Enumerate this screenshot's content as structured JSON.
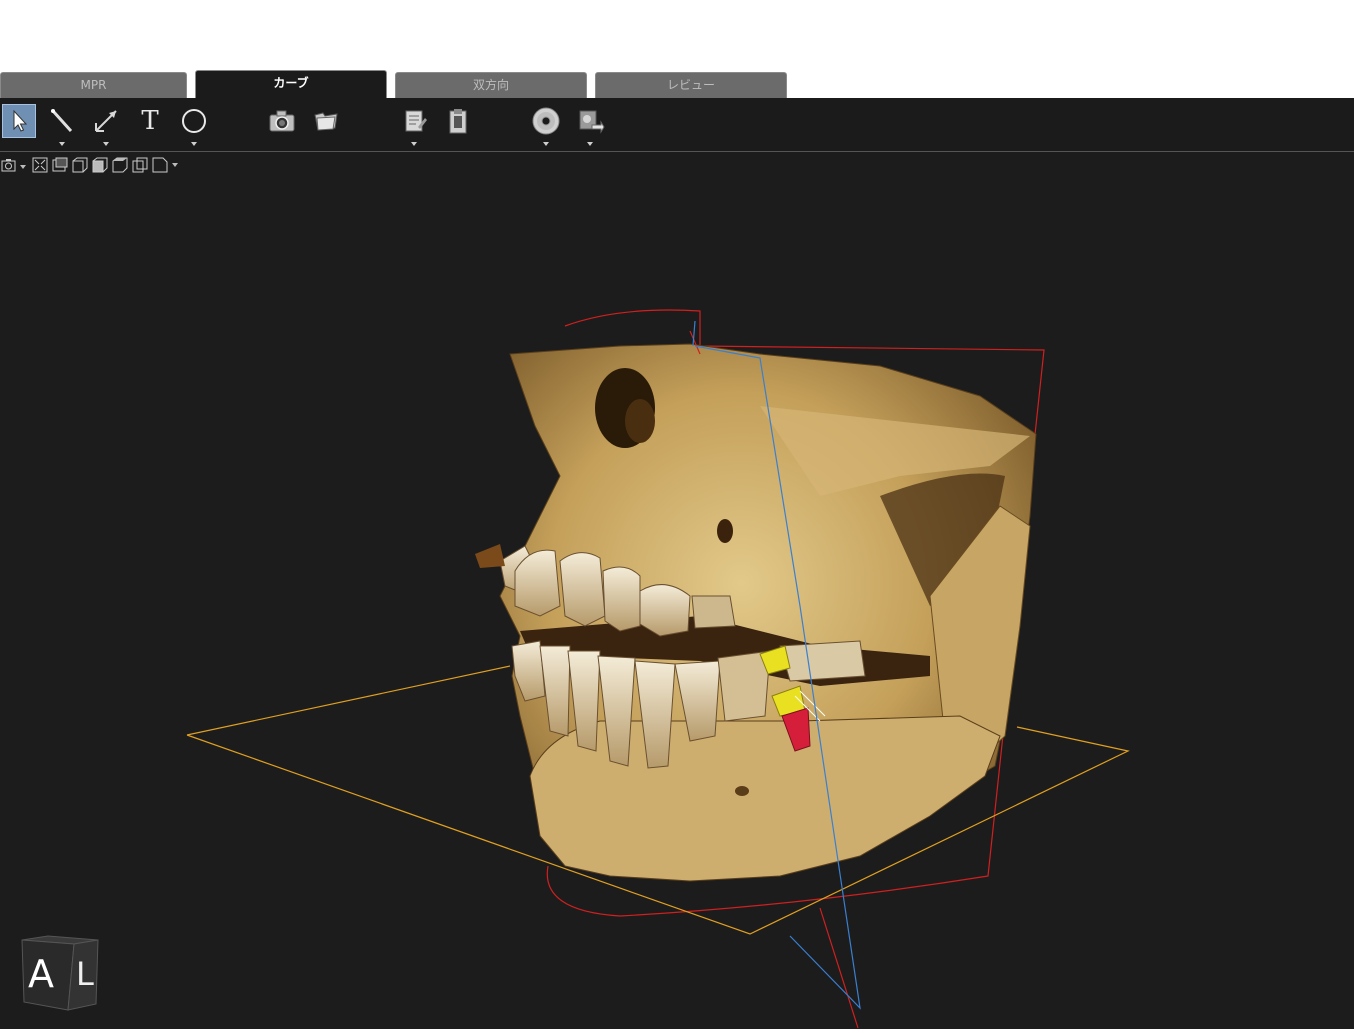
{
  "tabs": [
    {
      "label": "MPR",
      "active": false
    },
    {
      "label": "カーブ",
      "active": true
    },
    {
      "label": "双方向",
      "active": false
    },
    {
      "label": "レビュー",
      "active": false
    }
  ],
  "toolbar": {
    "tools": [
      "select-arrow-icon",
      "line-measure-icon",
      "angle-measure-icon",
      "text-tool-icon",
      "ellipse-tool-icon",
      "camera-icon",
      "folder-icon",
      "report-icon",
      "clipboard-icon",
      "disc-icon",
      "export-icon"
    ],
    "text_tool_glyph": "T",
    "selected_tool": "select-arrow-icon"
  },
  "subtoolbar": {
    "icons": [
      "snapshot-icon",
      "fit-view-icon",
      "layout-icon",
      "view-front-icon",
      "view-side-icon",
      "view-top-icon",
      "view-iso-icon",
      "view-menu-icon"
    ]
  },
  "orientation_cube": {
    "face_front": "A",
    "face_side": "L"
  },
  "colors": {
    "background": "#1c1c1c",
    "axial_plane": "#e0a020",
    "coronal_plane": "#d02020",
    "sagittal_plane": "#3a7fd0",
    "bone": "#c9a865",
    "implant": "#e8e020"
  }
}
